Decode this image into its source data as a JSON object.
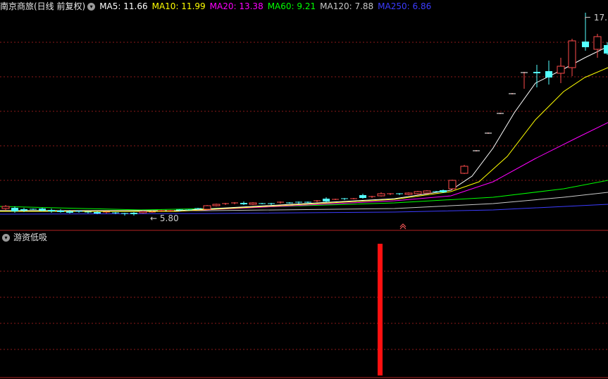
{
  "header": {
    "stock_title": "南京商旅(日线 前复权)",
    "ma": [
      {
        "label": "MA5: 11.66",
        "color": "#ffffff"
      },
      {
        "label": "MA10: 11.99",
        "color": "#ffff00"
      },
      {
        "label": "MA20: 13.38",
        "color": "#ff00ff"
      },
      {
        "label": "MA60: 9.21",
        "color": "#00ff00"
      },
      {
        "label": "MA120: 7.88",
        "color": "#c8c8c8"
      },
      {
        "label": "MA250: 6.86",
        "color": "#3c3cff"
      }
    ]
  },
  "annotations": {
    "low_price": "5.80",
    "high_price": "17."
  },
  "indicator": {
    "title": "游资低吸"
  },
  "colors": {
    "up": "#ff4b4b",
    "down": "#54ffff",
    "grid": "#8b1a1a",
    "signal_bar": "#ff1010"
  }
}
